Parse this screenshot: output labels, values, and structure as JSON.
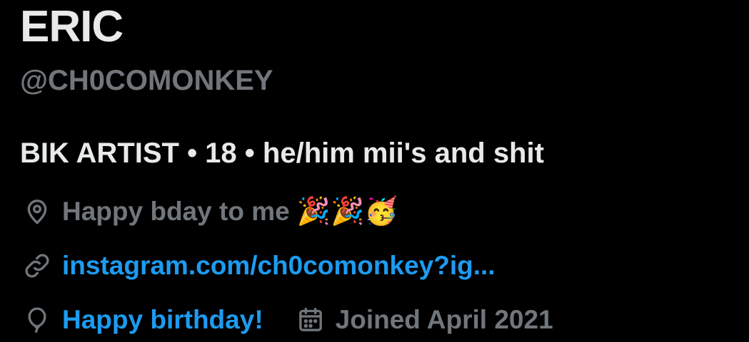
{
  "profile": {
    "display_name": "ERIC",
    "handle": "@CH0COMONKEY",
    "bio": "BIK ARTIST • 18 • he/him mii's and shit",
    "location": "Happy bday to me",
    "location_emoji": "🎉🎉🥳",
    "website": "instagram.com/ch0comonkey?ig...",
    "birthday": "Happy birthday!",
    "joined": "Joined April 2021"
  },
  "icons": {
    "location": "location-pin-icon",
    "website": "link-icon",
    "birthday": "balloon-icon",
    "joined": "calendar-icon"
  },
  "colors": {
    "background": "#000000",
    "primary_text": "#e7e9ea",
    "secondary_text": "#71767b",
    "link": "#1d9bf0"
  }
}
